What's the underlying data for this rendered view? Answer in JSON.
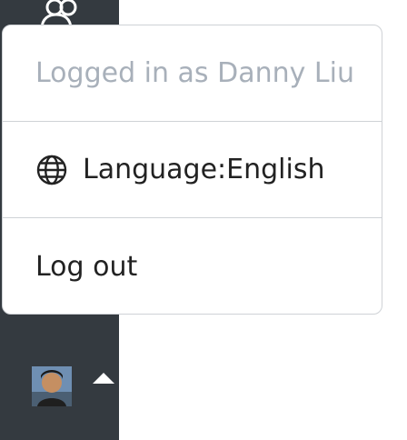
{
  "menu": {
    "logged_in": "Logged in as Danny Liu",
    "language_label": "Language:English",
    "logout_label": "Log out"
  },
  "icons": {
    "users": "users-icon",
    "globe": "globe-icon",
    "avatar": "user-avatar",
    "caret": "caret-up-icon"
  },
  "colors": {
    "sidebar": "#343a40",
    "muted_text": "#a8b0ba",
    "border": "#cfd2d6"
  }
}
